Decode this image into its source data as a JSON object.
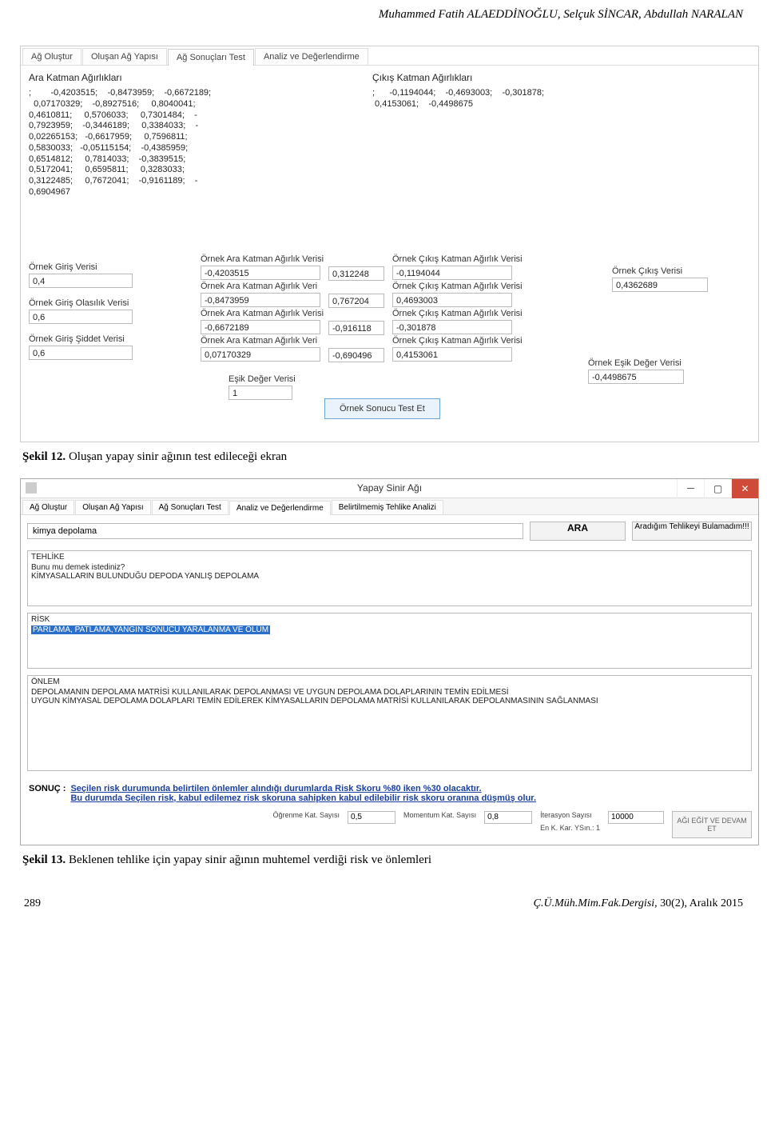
{
  "header": {
    "authors": "Muhammed Fatih ALAEDDİNOĞLU, Selçuk SİNCAR, Abdullah NARALAN"
  },
  "fig1": {
    "tabs": [
      "Ağ Oluştur",
      "Oluşan Ağ Yapısı",
      "Ağ Sonuçları Test",
      "Analiz ve Değerlendirme"
    ],
    "active_tab_index": 2,
    "ara_label": "Ara Katman Ağırlıkları",
    "cikis_label": "Çıkış Katman Ağırlıkları",
    "ara_weights": ";        -0,4203515;    -0,8473959;    -0,6672189;\n  0,07170329;    -0,8927516;     0,8040041;\n0,4610811;     0,5706033;     0,7301484;    -\n0,7923959;    -0,3446189;     0,3384033;    -\n0,02265153;   -0,6617959;     0,7596811;\n0,5830033;   -0,05115154;    -0,4385959;\n0,6514812;     0,7814033;    -0,3839515;\n0,5172041;     0,6595811;     0,3283033;\n0,3122485;     0,7672041;    -0,9161189;    -\n0,6904967",
    "cikis_weights": ";      -0,1194044;    -0,4693003;    -0,301878;\n 0,4153061;    -0,4498675",
    "fields": {
      "giris_label": "Örnek Giriş Verisi",
      "giris_val": "0,4",
      "olasilik_label": "Örnek Giriş Olasılık Verisi",
      "olasilik_val": "0,6",
      "siddet_label": "Örnek Giriş Şiddet Verisi",
      "siddet_val": "0,6",
      "ara1_label": "Örnek Ara Katman Ağırlık Verisi",
      "ara1_val": "-0,4203515",
      "ara2_label": "Örnek Ara Katman Ağırlık Veri",
      "ara2_val": "-0,8473959",
      "ara3_label": "Örnek Ara Katman Ağırlık Verisi",
      "ara3_val": "-0,6672189",
      "ara4_label": "Örnek Ara Katman Ağırlık Veri",
      "ara4_val": "0,07170329",
      "mid1_val": "0,312248",
      "mid2_val": "0,767204",
      "mid3_val": "-0,916118",
      "mid4_val": "-0,690496",
      "cik1_label": "Örnek Çıkış Katman Ağırlık Verisi",
      "cik1_val": "-0,1194044",
      "cik2_label": "Örnek Çıkış Katman Ağırlık Verisi",
      "cik2_val": "0,4693003",
      "cik3_label": "Örnek Çıkış Katman Ağırlık Verisi",
      "cik3_val": "-0,301878",
      "cik4_label": "Örnek Çıkış Katman Ağırlık Verisi",
      "cik4_val": "0,4153061",
      "out_label": "Örnek Çıkış Verisi",
      "out_val": "0,4362689",
      "esik2_label": "Örnek Eşik Değer Verisi",
      "esik2_val": "-0,4498675",
      "esik_label": "Eşik Değer Verisi",
      "esik_val": "1",
      "test_btn": "Örnek Sonucu Test Et"
    }
  },
  "caption1": {
    "bold": "Şekil 12.",
    "text": " Oluşan yapay sinir ağının test edileceği ekran"
  },
  "fig2": {
    "title": "Yapay Sinir Ağı",
    "tabs": [
      "Ağ Oluştur",
      "Oluşan Ağ Yapısı",
      "Ağ Sonuçları Test",
      "Analiz ve Değerlendirme",
      "Belirtilmemiş Tehlike Analizi"
    ],
    "active_tab_index": 3,
    "search_val": "kimya depolama",
    "ara_btn": "ARA",
    "notfound_btn": "Aradığım Tehlikeyi Bulamadım!!!",
    "tehlike": {
      "hdr": "TEHLİKE",
      "q": "Bunu mu demek istediniz?",
      "line": "KİMYASALLARIN BULUNDUĞU DEPODA YANLIŞ DEPOLAMA"
    },
    "risk": {
      "hdr": "RİSK",
      "line": "PARLAMA, PATLAMA,YANGIN SONUCU YARALANMA VE ÖLÜM"
    },
    "onlem": {
      "hdr": "ÖNLEM",
      "line1": "DEPOLAMANIN DEPOLAMA MATRİSİ KULLANILARAK DEPOLANMASI VE UYGUN DEPOLAMA DOLAPLARININ TEMİN EDİLMESİ",
      "line2": "UYGUN KİMYASAL DEPOLAMA DOLAPLARI TEMİN EDİLEREK KİMYASALLARIN DEPOLAMA MATRİSİ KULLANILARAK DEPOLANMASININ SAĞLANMASI"
    },
    "sonuc_label": "SONUÇ  :",
    "sonuc_line1": "Seçilen risk durumunda belirtilen önlemler alındığı durumlarda Risk Skoru %80 iken %30 olacaktır.",
    "sonuc_line2": "Bu durumda Seçilen risk, kabul edilemez risk skoruna sahipken kabul edilebilir risk skoru oranına düşmüş olur.",
    "params": {
      "ogrenme_label": "Öğrenme Kat. Sayısı",
      "ogrenme_val": "0,5",
      "momentum_label": "Momentum Kat. Sayısı",
      "momentum_val": "0,8",
      "iter_label": "İterasyon Sayısı",
      "iter_val": "10000",
      "enk_label": "En K. Kar. YSın.:",
      "enk_val": "1"
    },
    "train_btn": "AĞI EĞİT VE DEVAM ET"
  },
  "caption2": {
    "bold": "Şekil 13.",
    "text": " Beklenen tehlike için yapay sinir ağının muhtemel verdiği risk ve önlemleri"
  },
  "footer": {
    "page": "289",
    "journal_ital": "Ç.Ü.Müh.Mim.Fak.Dergisi,",
    "journal_rest": " 30(2), Aralık 2015"
  }
}
